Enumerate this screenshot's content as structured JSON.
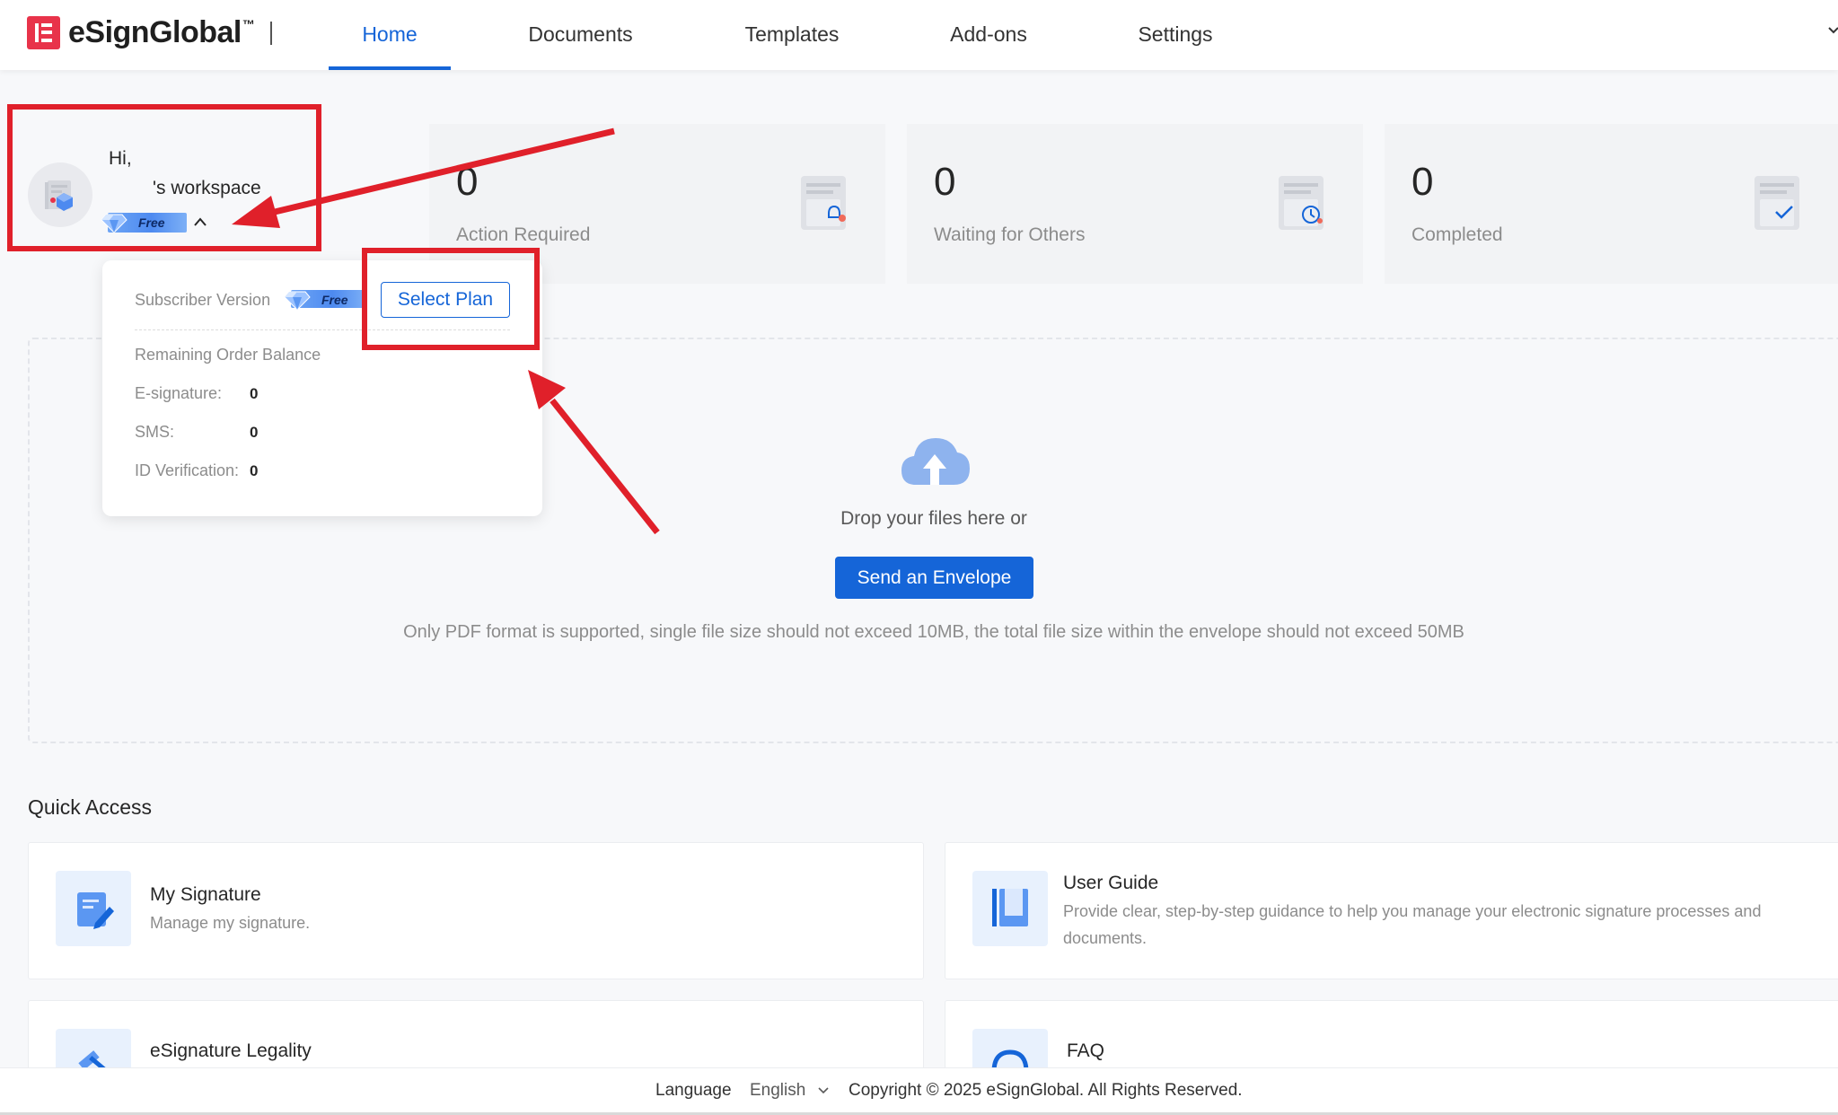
{
  "header": {
    "logo_text": "eSignGlobal",
    "logo_tm": "™",
    "nav": [
      {
        "label": "Home",
        "active": true
      },
      {
        "label": "Documents",
        "active": false
      },
      {
        "label": "Templates",
        "active": false
      },
      {
        "label": "Add-ons",
        "active": false
      },
      {
        "label": "Settings",
        "active": false
      }
    ]
  },
  "profile": {
    "greeting": "Hi,",
    "workspace": "'s workspace",
    "plan_badge": "Free"
  },
  "stats": [
    {
      "value": "0",
      "label": "Action Required",
      "icon": "bell-document-icon"
    },
    {
      "value": "0",
      "label": "Waiting for Others",
      "icon": "clock-document-icon"
    },
    {
      "value": "0",
      "label": "Completed",
      "icon": "check-document-icon"
    }
  ],
  "plan_popover": {
    "subscriber_version_label": "Subscriber Version",
    "plan_badge": "Free",
    "select_plan_label": "Select Plan",
    "remaining_title": "Remaining Order Balance",
    "balances": [
      {
        "label": "E-signature:",
        "value": "0"
      },
      {
        "label": "SMS:",
        "value": "0"
      },
      {
        "label": "ID Verification:",
        "value": "0"
      }
    ]
  },
  "upload": {
    "drop_text": "Drop your files here or",
    "send_button": "Send an Envelope",
    "format_note": "Only PDF format is supported, single file size should not exceed 10MB, the total file size within the envelope should not exceed 50MB"
  },
  "quick_access": {
    "title": "Quick Access",
    "items": [
      {
        "name": "My Signature",
        "desc": "Manage my signature.",
        "icon": "signature-pen-icon"
      },
      {
        "name": "User Guide",
        "desc": "Provide clear, step-by-step guidance to help you manage your electronic signature processes and documents.",
        "icon": "book-icon"
      },
      {
        "name": "eSignature Legality",
        "desc": "",
        "icon": "gavel-icon"
      },
      {
        "name": "FAQ",
        "desc": "",
        "icon": "headset-icon"
      }
    ]
  },
  "footer": {
    "language_label": "Language",
    "language_value": "English",
    "copyright": "Copyright © 2025 eSignGlobal. All Rights Reserved."
  },
  "colors": {
    "brand_red": "#e8334a",
    "primary_blue": "#1565d8",
    "annotation_red": "#e0202a"
  }
}
